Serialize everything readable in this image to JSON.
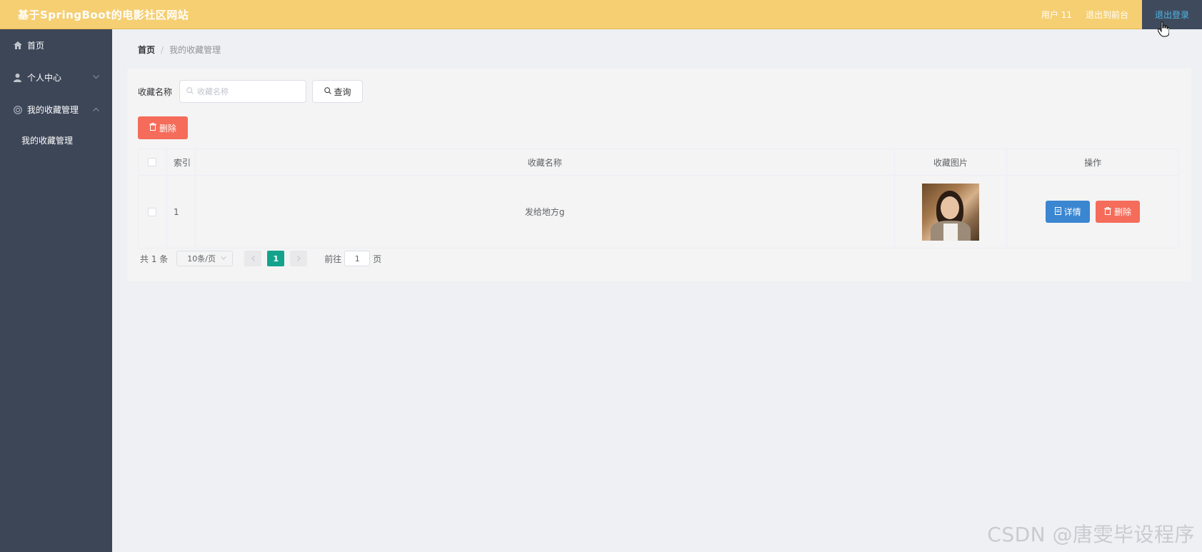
{
  "header": {
    "site_title": "基于SpringBoot的电影社区网站",
    "user_label": "用户 11",
    "back_to_front": "退出到前台",
    "logout": "退出登录"
  },
  "sidebar": {
    "items": [
      {
        "label": "首页",
        "icon": "home-icon"
      },
      {
        "label": "个人中心",
        "icon": "user-icon"
      },
      {
        "label": "我的收藏管理",
        "icon": "collection-icon"
      }
    ],
    "sub_items": [
      {
        "label": "我的收藏管理"
      }
    ]
  },
  "breadcrumb": {
    "home": "首页",
    "separator": "/",
    "current": "我的收藏管理"
  },
  "search": {
    "label": "收藏名称",
    "placeholder": "收藏名称",
    "query_button": "查询"
  },
  "toolbar": {
    "delete_label": "删除"
  },
  "table": {
    "headers": {
      "index": "索引",
      "name": "收藏名称",
      "image": "收藏图片",
      "ops": "操作"
    },
    "rows": [
      {
        "index": "1",
        "name": "发给地方g",
        "detail_label": "详情",
        "delete_label": "删除"
      }
    ]
  },
  "pagination": {
    "total": "共 1 条",
    "page_size": "10条/页",
    "current_page": "1",
    "goto_label": "前往",
    "goto_value": "1",
    "page_suffix": "页"
  },
  "watermark": "CSDN @唐雯毕设程序",
  "colors": {
    "header_bg": "#f5cf72",
    "sidebar_bg": "#3c4657",
    "danger": "#f56c5a",
    "primary": "#3a86d1",
    "page_active": "#13a38c"
  }
}
